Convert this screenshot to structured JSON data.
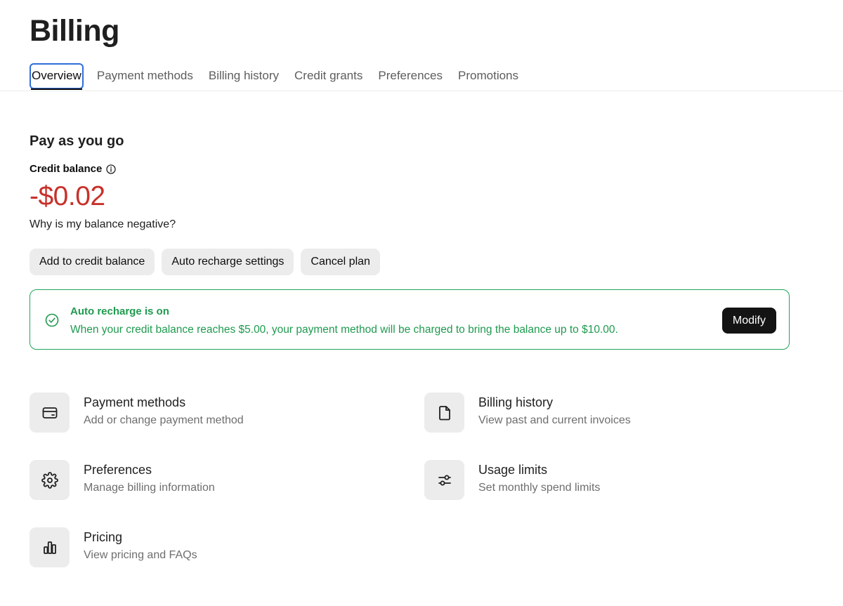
{
  "page": {
    "title": "Billing"
  },
  "tabs": [
    {
      "label": "Overview",
      "active": true
    },
    {
      "label": "Payment methods"
    },
    {
      "label": "Billing history"
    },
    {
      "label": "Credit grants"
    },
    {
      "label": "Preferences"
    },
    {
      "label": "Promotions"
    }
  ],
  "plan": {
    "title": "Pay as you go",
    "balance_label": "Credit balance",
    "balance_value": "-$0.02",
    "negative_link": "Why is my balance negative?"
  },
  "actions": {
    "add_credit": "Add to credit balance",
    "auto_recharge": "Auto recharge settings",
    "cancel_plan": "Cancel plan"
  },
  "alert": {
    "title": "Auto recharge is on",
    "text": "When your credit balance reaches $5.00, your payment method will be charged to bring the balance up to $10.00.",
    "button": "Modify"
  },
  "links": [
    {
      "title": "Payment methods",
      "subtitle": "Add or change payment method",
      "icon": "credit-card-icon"
    },
    {
      "title": "Billing history",
      "subtitle": "View past and current invoices",
      "icon": "document-icon"
    },
    {
      "title": "Preferences",
      "subtitle": "Manage billing information",
      "icon": "gear-icon"
    },
    {
      "title": "Usage limits",
      "subtitle": "Set monthly spend limits",
      "icon": "sliders-icon"
    },
    {
      "title": "Pricing",
      "subtitle": "View pricing and FAQs",
      "icon": "bar-chart-icon"
    }
  ],
  "colors": {
    "balance_negative": "#c8312b",
    "alert_green": "#1f9a4f",
    "focus_blue": "#2f6fd8"
  }
}
